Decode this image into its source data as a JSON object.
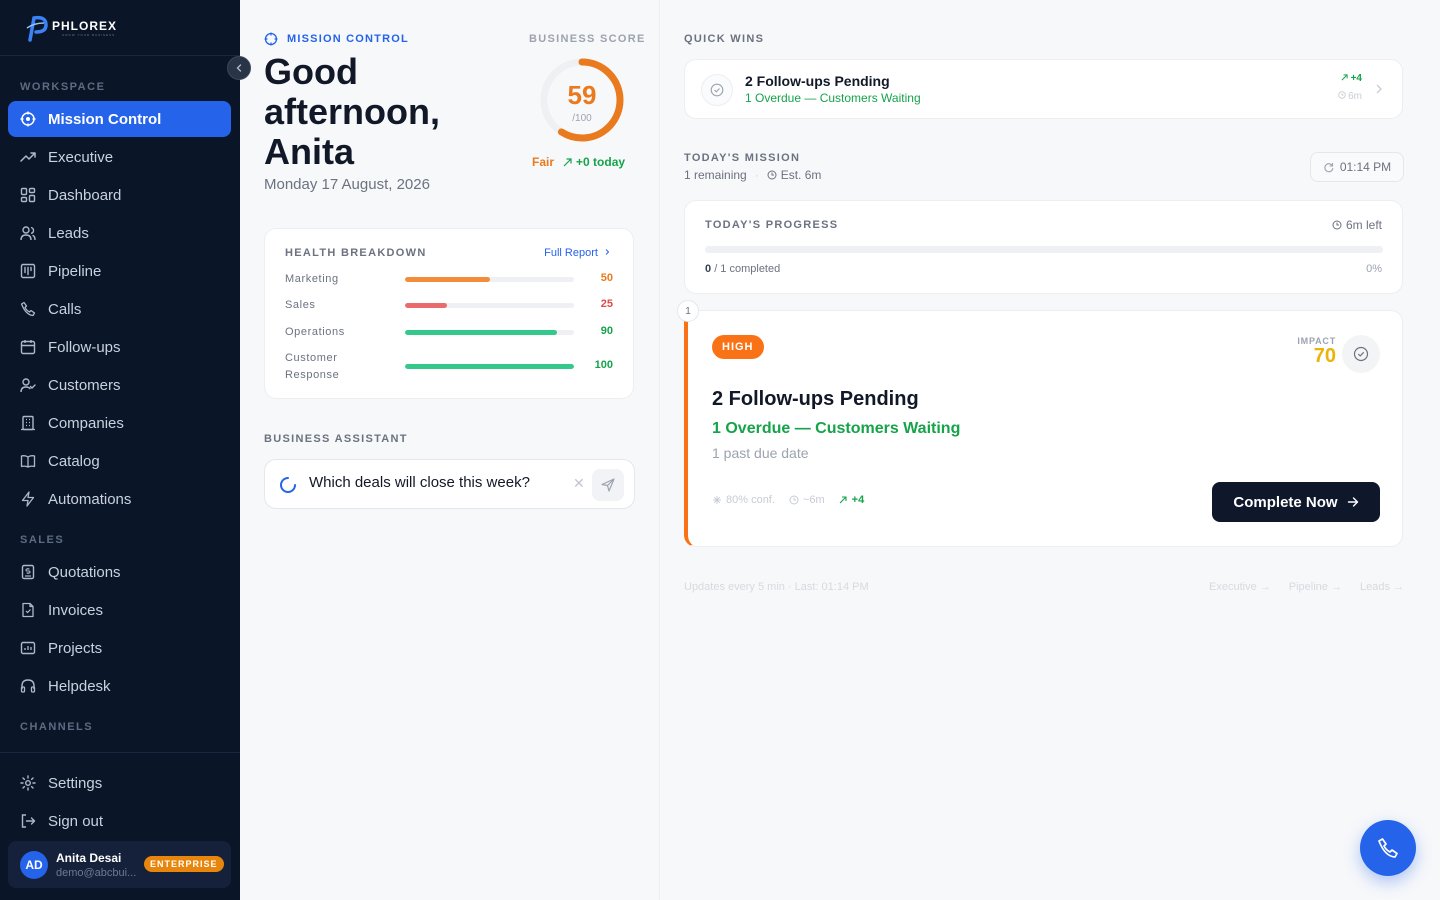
{
  "brand": {
    "name": "PHLOREX",
    "tagline": "GROW YOUR BUSINESS"
  },
  "sidebar": {
    "section_workspace": "WORKSPACE",
    "section_sales": "SALES",
    "section_channels": "CHANNELS",
    "workspace_items": [
      {
        "label": "Mission Control",
        "icon": "target-icon",
        "active": true
      },
      {
        "label": "Executive",
        "icon": "trending-up-icon"
      },
      {
        "label": "Dashboard",
        "icon": "grid-icon"
      },
      {
        "label": "Leads",
        "icon": "users-icon"
      },
      {
        "label": "Pipeline",
        "icon": "kanban-icon"
      },
      {
        "label": "Calls",
        "icon": "phone-icon"
      },
      {
        "label": "Follow-ups",
        "icon": "calendar-icon"
      },
      {
        "label": "Customers",
        "icon": "user-check-icon"
      },
      {
        "label": "Companies",
        "icon": "building-icon"
      },
      {
        "label": "Catalog",
        "icon": "book-icon"
      },
      {
        "label": "Automations",
        "icon": "zap-icon"
      }
    ],
    "sales_items": [
      {
        "label": "Quotations",
        "icon": "receipt-icon"
      },
      {
        "label": "Invoices",
        "icon": "file-icon"
      },
      {
        "label": "Projects",
        "icon": "folder-chart-icon"
      },
      {
        "label": "Helpdesk",
        "icon": "headphones-icon"
      }
    ],
    "bottom_items": [
      {
        "label": "Settings",
        "icon": "gear-icon"
      },
      {
        "label": "Sign out",
        "icon": "logout-icon"
      }
    ],
    "user": {
      "initials": "AD",
      "name": "Anita Desai",
      "email": "demo@abcbui...",
      "plan": "ENTERPRISE"
    }
  },
  "header": {
    "section_label": "MISSION CONTROL",
    "greeting": "Good afternoon, Anita",
    "date": "Monday 17 August, 2026"
  },
  "score": {
    "label": "BUSINESS SCORE",
    "value": "59",
    "max": "/100",
    "fraction": 0.59,
    "status": "Fair",
    "delta": "+0 today",
    "color": "#ea7a1e"
  },
  "health": {
    "title": "HEALTH BREAKDOWN",
    "link": "Full Report",
    "rows": [
      {
        "label": "Marketing",
        "value": "50",
        "pct": 50,
        "color": "#f28c3a",
        "text_color": "#ea7a1e"
      },
      {
        "label": "Sales",
        "value": "25",
        "pct": 25,
        "color": "#ea6b6b",
        "text_color": "#dc4b4b"
      },
      {
        "label": "Operations",
        "value": "90",
        "pct": 90,
        "color": "#34c98a",
        "text_color": "#16a34a"
      },
      {
        "label": "Customer Response",
        "value": "100",
        "pct": 100,
        "color": "#34c98a",
        "text_color": "#16a34a"
      }
    ]
  },
  "assistant": {
    "label": "BUSINESS ASSISTANT",
    "query": "Which deals will close this week?"
  },
  "quick_wins": {
    "label": "QUICK WINS",
    "items": [
      {
        "title": "2 Follow-ups Pending",
        "subtitle": "1 Overdue — Customers Waiting",
        "impact": "+4",
        "time": "6m"
      }
    ]
  },
  "mission": {
    "label": "TODAY'S MISSION",
    "remaining": "1 remaining",
    "estimate": "Est. 6m",
    "clock": "01:14 PM"
  },
  "progress": {
    "title": "TODAY'S PROGRESS",
    "time_left": "6m left",
    "completed_count": "0",
    "completed_rest": "/ 1 completed",
    "percent": "0%",
    "fraction": 0
  },
  "task": {
    "step": "1",
    "priority": "HIGH",
    "impact_label": "IMPACT",
    "impact": "70",
    "title": "2 Follow-ups Pending",
    "subtitle": "1 Overdue — Customers Waiting",
    "description": "1 past due date",
    "confidence": "80% conf.",
    "duration": "~6m",
    "gain": "+4",
    "cta": "Complete Now"
  },
  "footer": {
    "note": "Updates every 5 min · Last: 01:14 PM",
    "links": [
      "Executive →",
      "Pipeline →",
      "Leads →"
    ]
  }
}
